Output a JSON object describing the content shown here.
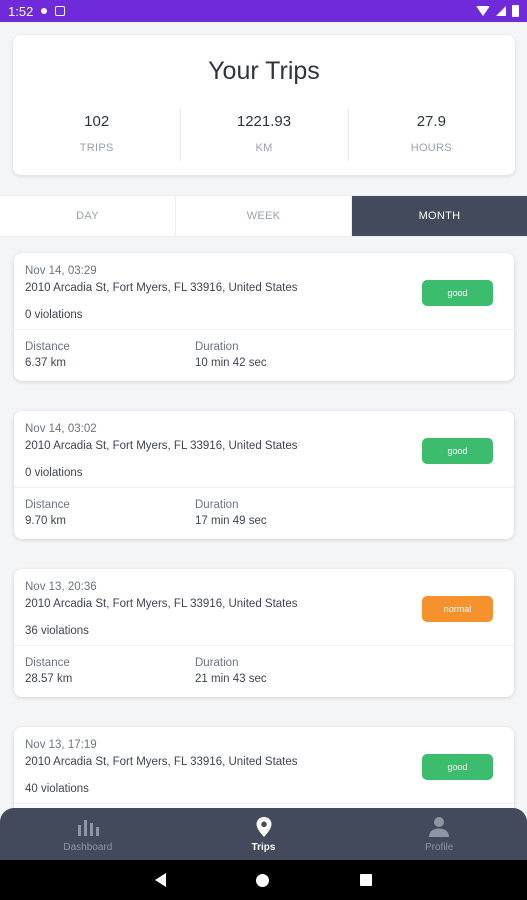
{
  "status_bar": {
    "time": "1:52"
  },
  "summary": {
    "title": "Your Trips",
    "stats": [
      {
        "value": "102",
        "label": "TRIPS"
      },
      {
        "value": "1221.93",
        "label": "KM"
      },
      {
        "value": "27.9",
        "label": "HOURS"
      }
    ]
  },
  "tabs": [
    {
      "label": "DAY",
      "active": false
    },
    {
      "label": "WEEK",
      "active": false
    },
    {
      "label": "MONTH",
      "active": true
    }
  ],
  "trip_labels": {
    "distance": "Distance",
    "duration": "Duration"
  },
  "trips": [
    {
      "date": "Nov 14, 03:29",
      "address": "2010 Arcadia St, Fort Myers, FL 33916, United States",
      "violations": "0 violations",
      "distance": "6.37 km",
      "duration": "10 min 42 sec",
      "badge": "good",
      "badge_color": "#3bbd6d"
    },
    {
      "date": "Nov 14, 03:02",
      "address": "2010 Arcadia St, Fort Myers, FL 33916, United States",
      "violations": "0 violations",
      "distance": "9.70 km",
      "duration": "17 min 49 sec",
      "badge": "good",
      "badge_color": "#3bbd6d"
    },
    {
      "date": "Nov 13, 20:36",
      "address": "2010 Arcadia St, Fort Myers, FL 33916, United States",
      "violations": "36 violations",
      "distance": "28.57 km",
      "duration": "21 min 43 sec",
      "badge": "normal",
      "badge_color": "#f5922e"
    },
    {
      "date": "Nov 13, 17:19",
      "address": "2010 Arcadia St, Fort Myers, FL 33916, United States",
      "violations": "40 violations",
      "distance": "",
      "duration": "",
      "badge": "good",
      "badge_color": "#3bbd6d"
    }
  ],
  "bottom_nav": [
    {
      "label": "Dashboard",
      "icon": "bar-chart-icon",
      "active": false
    },
    {
      "label": "Trips",
      "icon": "location-pin-icon",
      "active": true
    },
    {
      "label": "Profile",
      "icon": "person-icon",
      "active": false
    }
  ],
  "colors": {
    "status_bar": "#6f2bd9",
    "dark_accent": "#434a5c",
    "good": "#3bbd6d",
    "normal": "#f5922e"
  }
}
